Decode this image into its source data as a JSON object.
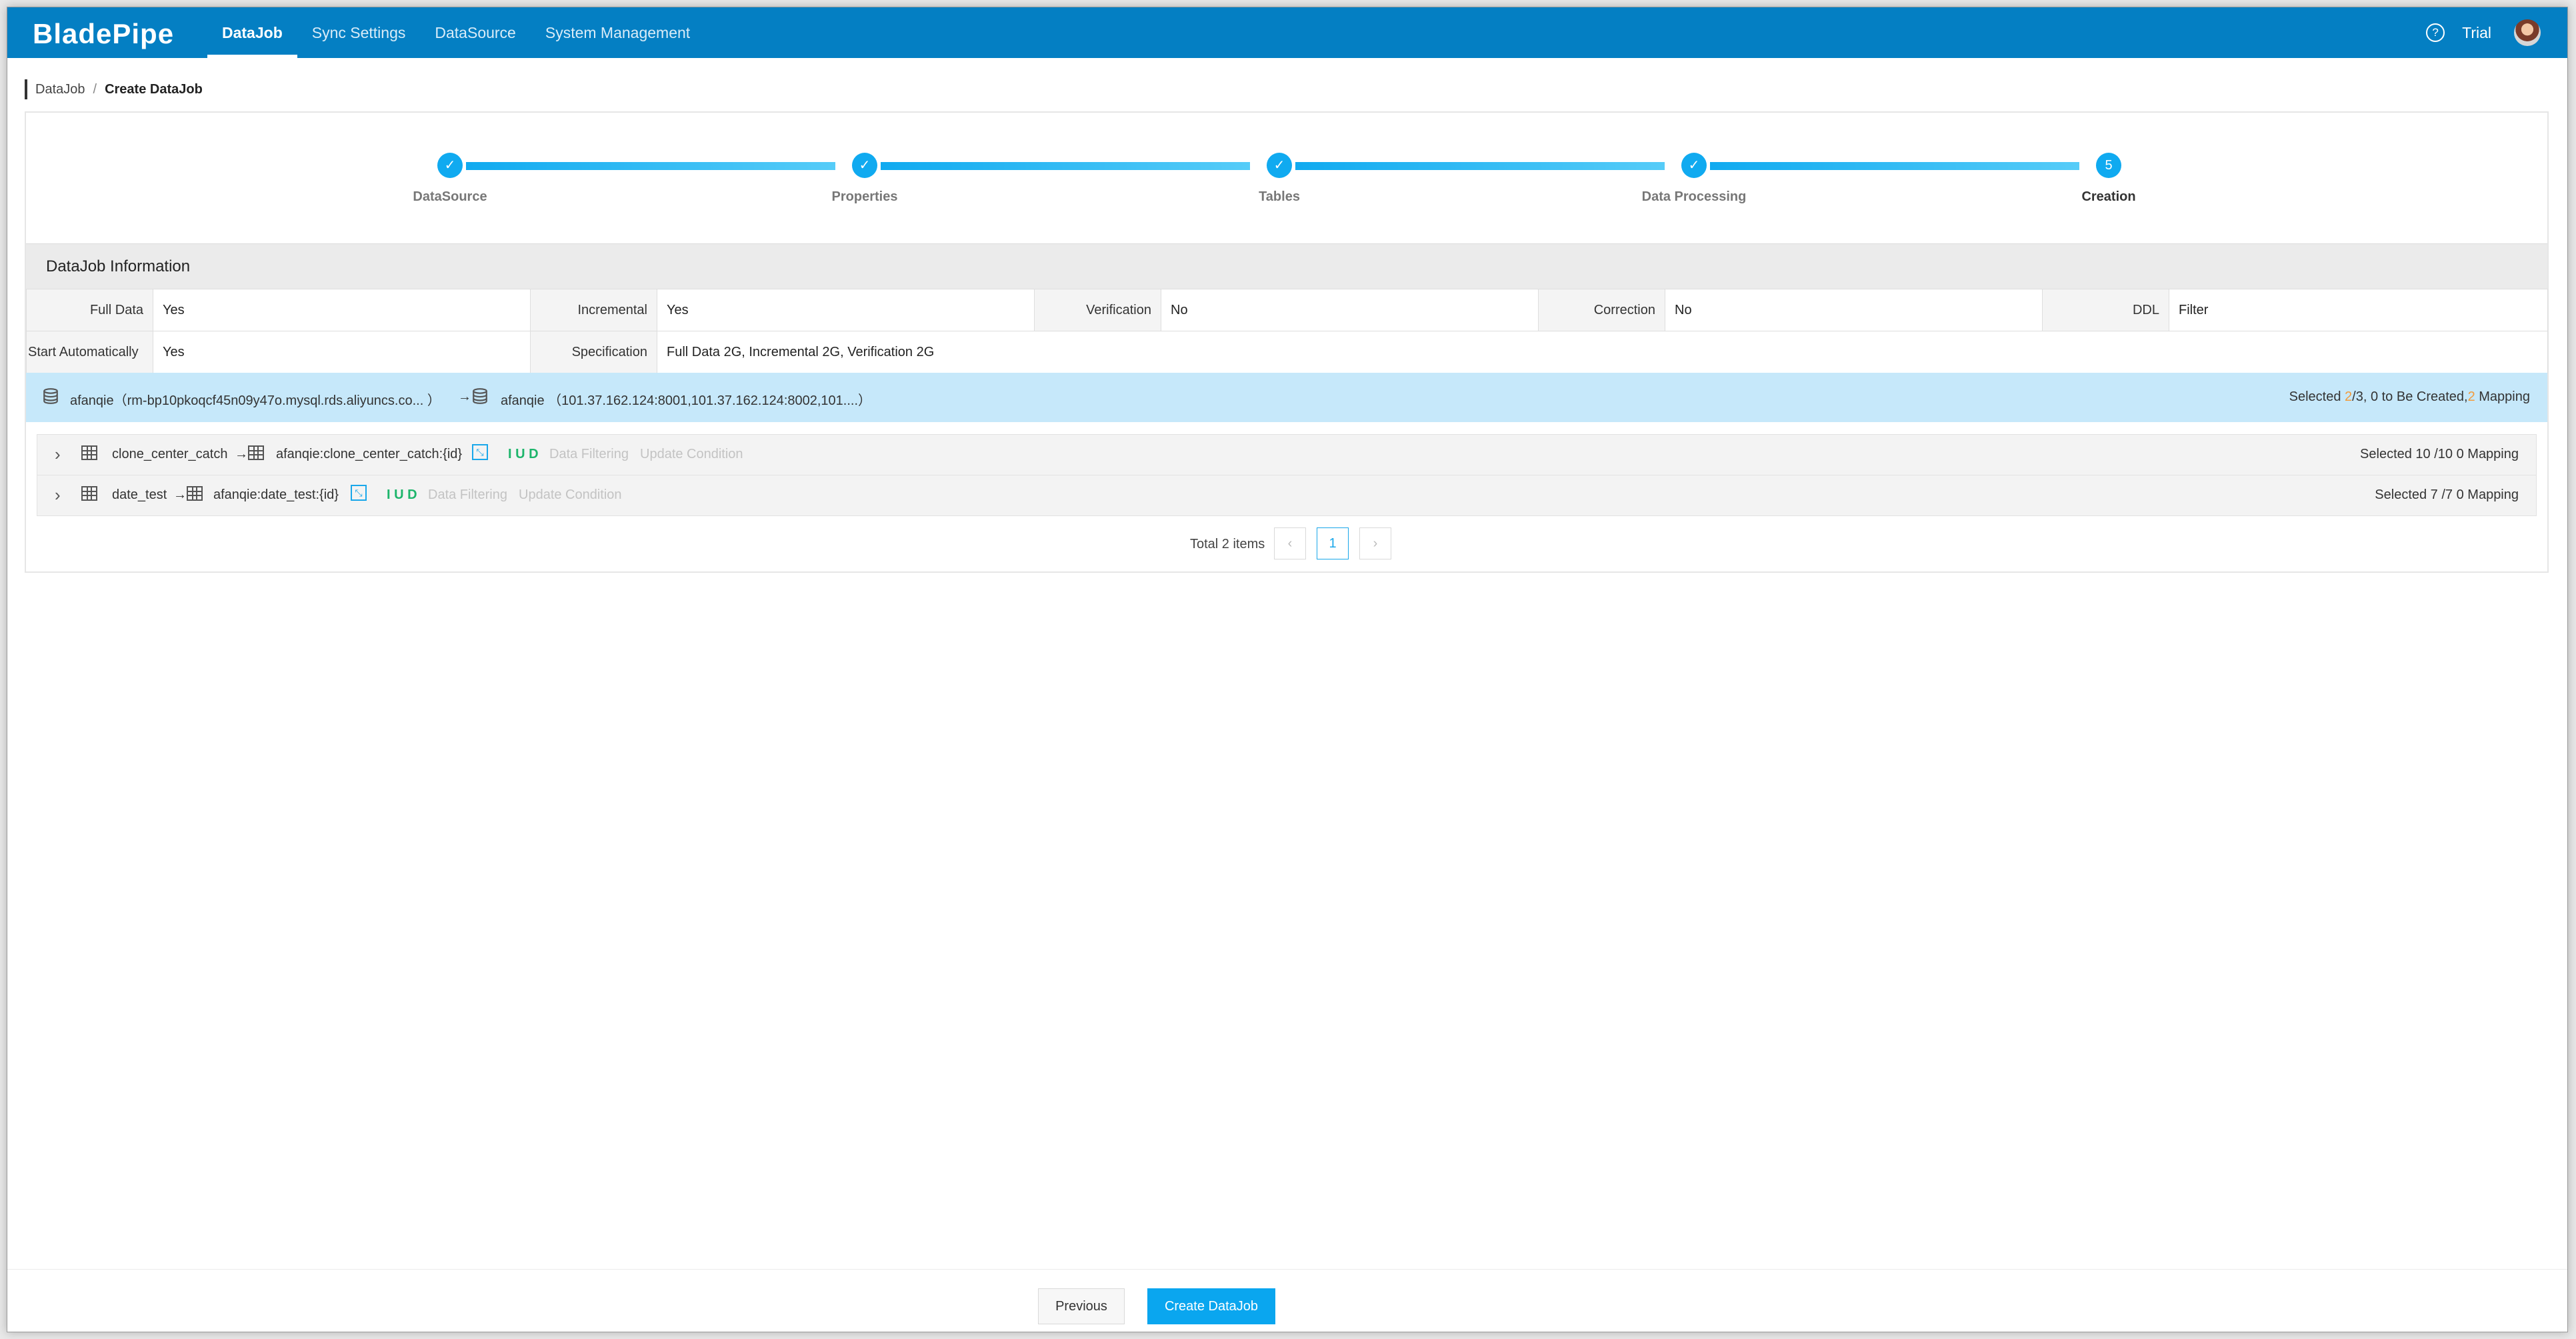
{
  "app": {
    "logo": "BladePipe"
  },
  "nav": {
    "items": [
      "DataJob",
      "Sync Settings",
      "DataSource",
      "System Management"
    ],
    "user": "Trial",
    "help_glyph": "?"
  },
  "breadcrumb": {
    "parent": "DataJob",
    "separator": "/",
    "current": "Create DataJob"
  },
  "steps": [
    {
      "label": "DataSource",
      "mark": "✓"
    },
    {
      "label": "Properties",
      "mark": "✓"
    },
    {
      "label": "Tables",
      "mark": "✓"
    },
    {
      "label": "Data Processing",
      "mark": "✓"
    },
    {
      "label": "Creation",
      "mark": "5"
    }
  ],
  "info": {
    "title": "DataJob Information",
    "row1": [
      {
        "key": "Full Data",
        "value": "Yes"
      },
      {
        "key": "Incremental",
        "value": "Yes"
      },
      {
        "key": "Verification",
        "value": "No"
      },
      {
        "key": "Correction",
        "value": "No"
      },
      {
        "key": "DDL",
        "value": "Filter"
      }
    ],
    "row2": [
      {
        "key": "Start Automatically",
        "value": "Yes"
      },
      {
        "key": "Specification",
        "value": "Full Data 2G, Incremental 2G, Verification 2G"
      }
    ]
  },
  "mapping": {
    "source": "afanqie（rm-bp10pkoqcf45n09y47o.mysql.rds.aliyuncs.co...  ）",
    "arrow": "→",
    "target": "afanqie  （101.37.162.124:8001,101.37.162.124:8002,101....）",
    "summary_prefix": "Selected ",
    "selected": "2",
    "summary_mid": "/3, 0 to Be Created,",
    "mapping_count": "2",
    "summary_suffix": " Mapping"
  },
  "tables": [
    {
      "source": "clone_center_catch",
      "target": "afanqie:clone_center_catch:{id}",
      "ops": "I U D",
      "filter": "Data Filtering",
      "update": "Update Condition",
      "summary": "Selected 10 /10 0 Mapping"
    },
    {
      "source": "date_test",
      "target": "afanqie:date_test:{id}",
      "ops": "I U D",
      "filter": "Data Filtering",
      "update": "Update Condition",
      "summary": "Selected 7 /7 0 Mapping"
    }
  ],
  "pagination": {
    "total": "Total 2 items",
    "prev": "‹",
    "page": "1",
    "next": "›"
  },
  "footer": {
    "previous": "Previous",
    "create": "Create DataJob"
  },
  "colors": {
    "nav": "#047fc3",
    "accent": "#10aaf0",
    "mapping_bg": "#c6e8fa",
    "highlight": "#f39b3b",
    "ops": "#1db56b"
  }
}
